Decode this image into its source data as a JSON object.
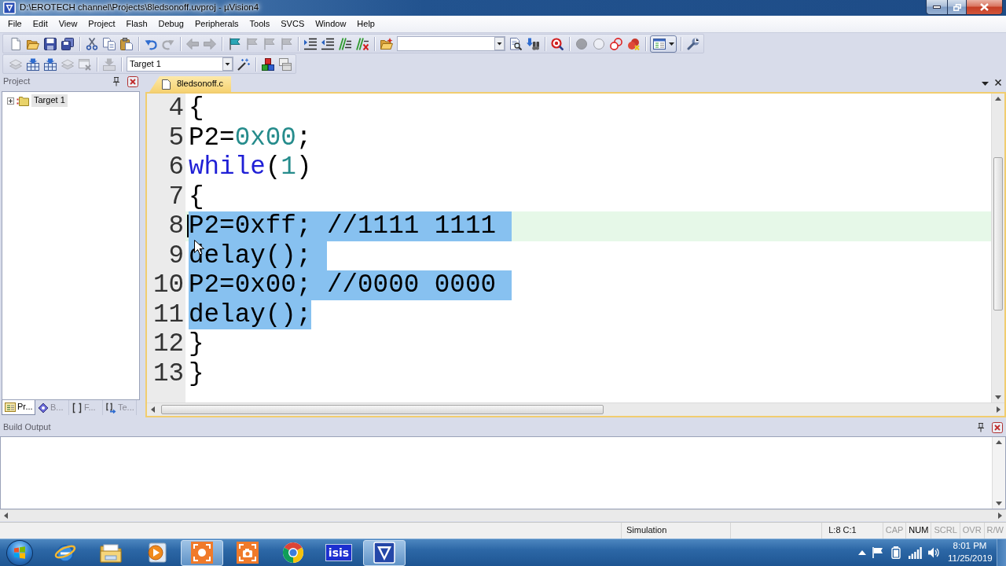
{
  "window": {
    "title": "D:\\EROTECH channel\\Projects\\8ledsonoff.uvproj - µVision4"
  },
  "menu": [
    "File",
    "Edit",
    "View",
    "Project",
    "Flash",
    "Debug",
    "Peripherals",
    "Tools",
    "SVCS",
    "Window",
    "Help"
  ],
  "toolbars": [
    {
      "groups": [
        {
          "items": [
            {
              "kind": "button",
              "disabled": false,
              "pressed": false
            },
            {
              "kind": "button",
              "disabled": false,
              "pressed": false
            },
            {
              "kind": "button",
              "disabled": false,
              "pressed": false
            },
            {
              "kind": "button",
              "disabled": false,
              "pressed": false
            }
          ]
        },
        {
          "items": [
            {
              "kind": "button",
              "disabled": false,
              "pressed": false
            },
            {
              "kind": "button",
              "disabled": false,
              "pressed": false
            },
            {
              "kind": "button",
              "disabled": false,
              "pressed": false
            }
          ]
        },
        {
          "items": [
            {
              "kind": "button",
              "disabled": false,
              "pressed": false
            },
            {
              "kind": "button",
              "disabled": true,
              "pressed": false
            }
          ]
        },
        {
          "items": [
            {
              "kind": "button",
              "disabled": true,
              "pressed": false
            },
            {
              "kind": "button",
              "disabled": true,
              "pressed": false
            }
          ]
        },
        {
          "items": [
            {
              "kind": "button",
              "disabled": false,
              "pressed": false
            },
            {
              "kind": "button",
              "disabled": true,
              "pressed": false
            },
            {
              "kind": "button",
              "disabled": true,
              "pressed": false
            },
            {
              "kind": "button",
              "disabled": true,
              "pressed": false
            }
          ]
        },
        {
          "items": [
            {
              "kind": "button",
              "disabled": false,
              "pressed": false
            },
            {
              "kind": "button",
              "disabled": false,
              "pressed": false
            },
            {
              "kind": "button",
              "disabled": false,
              "pressed": false
            },
            {
              "kind": "button",
              "disabled": false,
              "pressed": false
            }
          ]
        },
        {
          "items": [
            {
              "kind": "button",
              "disabled": false,
              "pressed": false
            },
            {
              "kind": "combo"
            },
            {
              "kind": "button",
              "disabled": false,
              "pressed": false
            },
            {
              "kind": "button",
              "disabled": false,
              "pressed": false
            }
          ]
        },
        {
          "items": [
            {
              "kind": "button",
              "disabled": false,
              "pressed": false
            }
          ]
        },
        {
          "items": [
            {
              "kind": "button",
              "disabled": true,
              "pressed": false
            },
            {
              "kind": "button",
              "disabled": true,
              "pressed": false
            },
            {
              "kind": "button",
              "disabled": false,
              "pressed": false
            },
            {
              "kind": "button",
              "disabled": false,
              "pressed": false
            }
          ]
        },
        {
          "items": [
            {
              "kind": "dropdown",
              "disabled": false,
              "pressed": true
            }
          ]
        },
        {
          "items": [
            {
              "kind": "button",
              "disabled": false,
              "pressed": false
            }
          ]
        }
      ]
    },
    {
      "groups": [
        {
          "items": [
            {
              "kind": "button",
              "disabled": true,
              "pressed": false
            },
            {
              "kind": "button",
              "disabled": false,
              "pressed": false
            },
            {
              "kind": "button",
              "disabled": false,
              "pressed": false
            },
            {
              "kind": "button",
              "disabled": true,
              "pressed": false
            },
            {
              "kind": "button",
              "disabled": true,
              "pressed": false
            }
          ]
        },
        {
          "items": [
            {
              "kind": "button",
              "disabled": true,
              "pressed": false
            }
          ]
        },
        {
          "items": [
            {
              "kind": "combo",
              "value": "Target 1"
            },
            {
              "kind": "button",
              "disabled": false,
              "pressed": false
            }
          ]
        },
        {
          "items": [
            {
              "kind": "button",
              "disabled": false,
              "pressed": false
            },
            {
              "kind": "button",
              "disabled": false,
              "pressed": false
            }
          ]
        }
      ]
    }
  ],
  "project_panel": {
    "title": "Project",
    "tree": [
      {
        "label": "Target 1",
        "expanded": false,
        "selected": true
      }
    ],
    "tabs": [
      {
        "label": "Pr...",
        "selected": true
      },
      {
        "label": "B...",
        "selected": false
      },
      {
        "label": "F...",
        "selected": false
      },
      {
        "label": "Te...",
        "selected": false
      }
    ]
  },
  "editor": {
    "tabs": [
      {
        "label": "8ledsonoff.c",
        "selected": true
      }
    ],
    "lines": [
      {
        "number": "4",
        "selected": false,
        "current": false,
        "tokens": [
          {
            "kind": "plain",
            "text": "{"
          }
        ]
      },
      {
        "number": "5",
        "selected": false,
        "current": false,
        "tokens": [
          {
            "kind": "plain",
            "text": "P2="
          },
          {
            "kind": "number",
            "text": "0x00"
          },
          {
            "kind": "plain",
            "text": ";"
          }
        ]
      },
      {
        "number": "6",
        "selected": false,
        "current": false,
        "tokens": [
          {
            "kind": "keyword",
            "text": "while"
          },
          {
            "kind": "plain",
            "text": "("
          },
          {
            "kind": "number",
            "text": "1"
          },
          {
            "kind": "plain",
            "text": ")"
          }
        ]
      },
      {
        "number": "7",
        "selected": false,
        "current": false,
        "tokens": [
          {
            "kind": "plain",
            "text": "{"
          }
        ]
      },
      {
        "number": "8",
        "selected": true,
        "current": true,
        "tokens": [
          {
            "kind": "plain",
            "text": "P2=0xff; //1111 1111"
          }
        ]
      },
      {
        "number": "9",
        "selected": true,
        "current": false,
        "tokens": [
          {
            "kind": "plain",
            "text": "delay();"
          }
        ]
      },
      {
        "number": "10",
        "selected": true,
        "current": false,
        "tokens": [
          {
            "kind": "plain",
            "text": "P2=0x00; //0000 0000"
          }
        ]
      },
      {
        "number": "11",
        "selected": true,
        "current": false,
        "tokens": [
          {
            "kind": "plain",
            "text": "delay();"
          }
        ]
      },
      {
        "number": "12",
        "selected": false,
        "current": false,
        "tokens": [
          {
            "kind": "plain",
            "text": "}"
          }
        ]
      },
      {
        "number": "13",
        "selected": false,
        "current": false,
        "tokens": [
          {
            "kind": "plain",
            "text": "}"
          }
        ]
      }
    ]
  },
  "build_output": {
    "title": "Build Output"
  },
  "status_bar": {
    "mode": "Simulation",
    "cursor": "L:8 C:1",
    "indicators": [
      {
        "label": "CAP",
        "on": false
      },
      {
        "label": "NUM",
        "on": true
      },
      {
        "label": "SCRL",
        "on": false
      },
      {
        "label": "OVR",
        "on": false
      },
      {
        "label": "R/W",
        "on": false
      }
    ]
  },
  "taskbar": {
    "apps": [
      {
        "active": false
      },
      {
        "active": false
      },
      {
        "active": false
      },
      {
        "active": true
      },
      {
        "active": false
      },
      {
        "active": false
      },
      {
        "active": false,
        "label": "isis"
      },
      {
        "active": true
      }
    ],
    "clock": {
      "time": "8:01 PM",
      "date": "11/25/2019"
    }
  }
}
